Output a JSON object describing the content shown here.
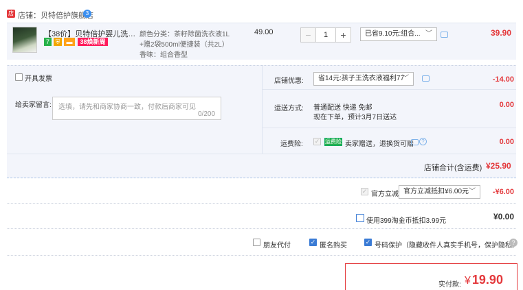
{
  "shop": {
    "icon_text": "店",
    "label": "店铺：贝特倍护旗舰店",
    "badge": "3"
  },
  "item": {
    "title": "【38价】贝特倍护婴儿洗衣液...",
    "tags": {
      "seven": "7",
      "shield": "⛨",
      "card": "▬",
      "promo": "38焕新周"
    },
    "sku_lines": [
      "颜色分类：茶籽除菌洗衣液1L",
      "+赠2袋500ml便捷装（共2L）",
      "香味：组合香型"
    ],
    "unit_price": "49.00",
    "qty_minus": "−",
    "qty": "1",
    "qty_plus": "+",
    "promo_select": "已省9.10元:组合...",
    "total": "39.90"
  },
  "options": {
    "invoice_label": "开具发票",
    "message_label": "给卖家留言:",
    "message_placeholder": "选填，请先和商家协商一致，付款后商家可见",
    "message_counter": "0/200",
    "coupon_label": "店铺优惠:",
    "coupon_select": "省14元:孩子王洗衣液福利77",
    "coupon_amount": "-14.00",
    "shipping_label": "运送方式:",
    "shipping_method": "普通配送 快递 免邮",
    "shipping_eta": "现在下单，预计3月7日送达",
    "shipping_amount": "0.00",
    "insurance_label": "运费险:",
    "insurance_badge": "运费险",
    "insurance_text": "卖家赠送，退换货可赔",
    "insurance_amount": "0.00"
  },
  "shop_total": {
    "label": "店铺合计(含运费)",
    "value": "¥25.90"
  },
  "discounts": {
    "gov_label": "官方立减",
    "gov_select": "官方立减抵扣¥6.00元",
    "gov_amount": "-¥6.00",
    "coin_label": "使用399淘金币抵扣3.99元",
    "coin_amount": "¥0.00"
  },
  "extras": {
    "friend_pay": "朋友代付",
    "anonymous": "匿名购买",
    "privacy": "号码保护（隐藏收件人真实手机号，保护隐私）",
    "help": "?"
  },
  "payment": {
    "label": "实付款:",
    "currency": "¥",
    "value": "19.90"
  },
  "colors": {
    "accent_red": "#e4393c",
    "panel_bg": "#f3f5fb",
    "check_blue": "#3a7bd5",
    "promo_pink": "#ff1c5c"
  }
}
